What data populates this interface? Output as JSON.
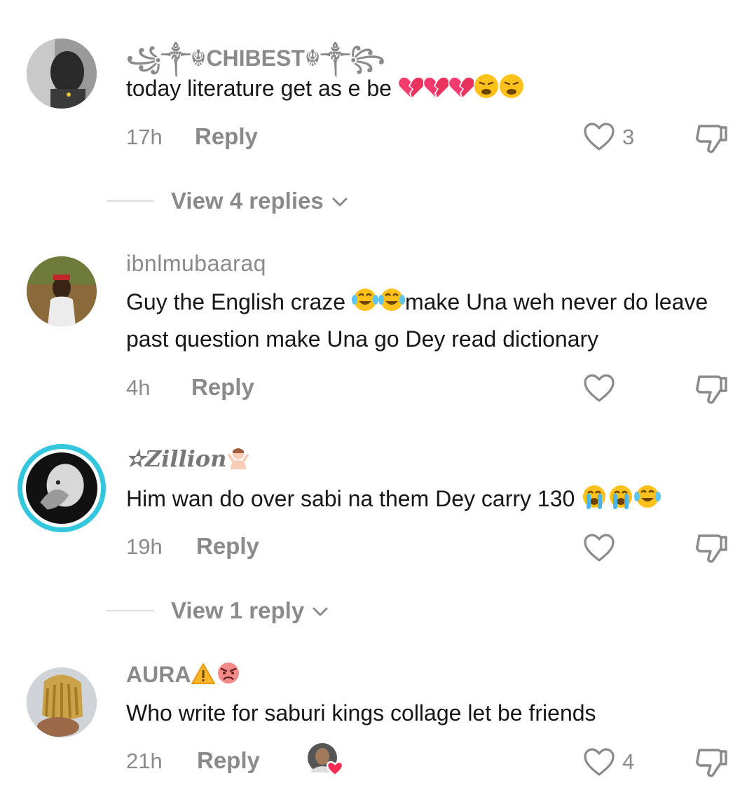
{
  "comments": [
    {
      "username": "꧁༒☬CHIBEST☬༒꧂",
      "text": "today literature get as e be",
      "emojis": [
        "broken-heart",
        "broken-heart",
        "broken-heart",
        "weary-face",
        "weary-face"
      ],
      "time": "17h",
      "reply_label": "Reply",
      "like_count": "3",
      "view_replies": "View 4 replies"
    },
    {
      "username": "ibnlmubaaraq",
      "text_part1": "Guy the English craze",
      "emojis": [
        "tears-of-joy",
        "tears-of-joy"
      ],
      "text_part2": "make Una weh never do leave past question make Una go Dey read dictionary",
      "time": "4h",
      "reply_label": "Reply",
      "like_count": ""
    },
    {
      "username": "✫Zillion",
      "username_emoji": "person-gesturing-no",
      "text": "Him wan do over sabi na them Dey carry 130",
      "emojis": [
        "loudly-crying",
        "loudly-crying",
        "tears-of-joy"
      ],
      "time": "19h",
      "reply_label": "Reply",
      "like_count": "",
      "view_replies": "View 1 reply"
    },
    {
      "username": "AURA",
      "username_emojis": [
        "warning",
        "angry-face"
      ],
      "text": "Who write for saburi kings collage let be friends",
      "time": "21h",
      "reply_label": "Reply",
      "like_count": "4",
      "creator_liked": true
    }
  ],
  "icons": {
    "like": "heart-outline-icon",
    "dislike": "thumbs-down-icon",
    "chevron": "chevron-down-icon"
  },
  "colors": {
    "story_ring": "#33c6dc",
    "creator_heart": "#fe2c55"
  }
}
